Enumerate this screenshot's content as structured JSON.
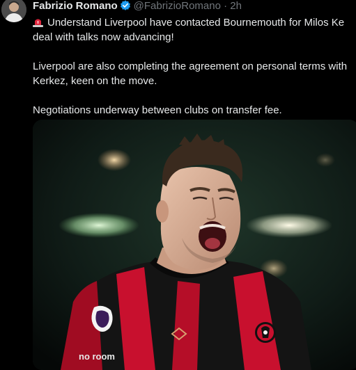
{
  "tweet": {
    "author_name": "Fabrizio Romano",
    "handle": "@FabrizioRomano",
    "separator": "·",
    "time": "2h",
    "paragraphs": [
      [
        "Understand Liverpool have contacted Bournemouth for Milos Ke",
        "deal with talks now advancing!"
      ],
      [
        "Liverpool are also completing the agreement on personal terms with",
        "Kerkez, keen on the move."
      ],
      [
        "Negotiations underway between clubs on transfer fee."
      ]
    ],
    "media": {
      "kit_sponsor_text": "no room"
    }
  },
  "icons": {
    "verified": "verified-badge-icon",
    "siren": "rotating-light-emoji"
  },
  "colors": {
    "background": "#000000",
    "text": "#e7e9ea",
    "secondary_text": "#71767b",
    "verified": "#1d9bf0",
    "kit_red": "#c8102e"
  }
}
